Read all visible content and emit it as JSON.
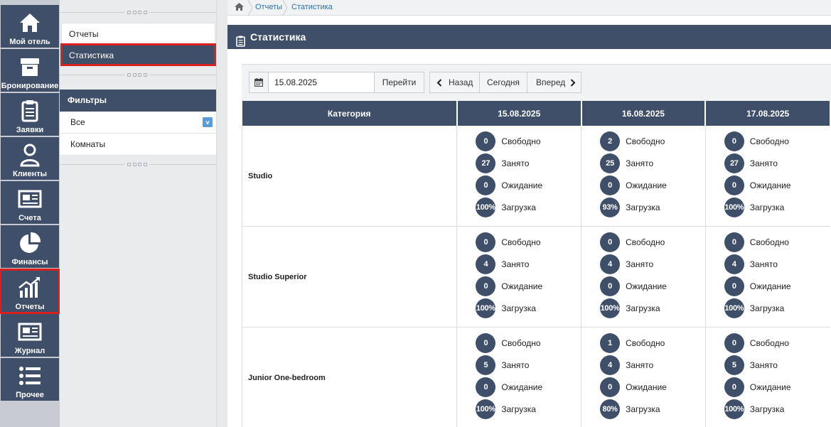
{
  "nav": [
    {
      "label": "Мой отель",
      "icon": "home-icon"
    },
    {
      "label": "Бронирование",
      "icon": "archive-box-icon"
    },
    {
      "label": "Заявки",
      "icon": "clipboard-icon"
    },
    {
      "label": "Клиенты",
      "icon": "user-icon"
    },
    {
      "label": "Счета",
      "icon": "invoice-icon"
    },
    {
      "label": "Финансы",
      "icon": "pie-chart-icon"
    },
    {
      "label": "Отчеты",
      "icon": "bar-chart-icon",
      "selected": true
    },
    {
      "label": "Журнал",
      "icon": "newspaper-icon"
    },
    {
      "label": "Прочее",
      "icon": "list-icon"
    }
  ],
  "submenu": {
    "items": [
      {
        "label": "Отчеты"
      },
      {
        "label": "Статистика",
        "active": true
      }
    ],
    "filters_title": "Фильтры",
    "filters": [
      {
        "label": "Все",
        "badge": "v"
      },
      {
        "label": "Комнаты"
      }
    ]
  },
  "breadcrumb": [
    "Отчеты",
    "Статистика"
  ],
  "page": {
    "title": "Статистика"
  },
  "toolbar": {
    "date_value": "15.08.2025",
    "go_label": "Перейти",
    "back_label": "Назад",
    "today_label": "Сегодня",
    "forward_label": "Вперед"
  },
  "table": {
    "category_header": "Категория",
    "dates": [
      "15.08.2025",
      "16.08.2025",
      "17.08.2025"
    ],
    "stat_labels": [
      "Свободно",
      "Занято",
      "Ожидание",
      "Загрузка"
    ],
    "rows": [
      {
        "category": "Studio",
        "cells": [
          [
            "0",
            "27",
            "0",
            "100%"
          ],
          [
            "2",
            "25",
            "0",
            "93%"
          ],
          [
            "0",
            "27",
            "0",
            "100%"
          ]
        ]
      },
      {
        "category": "Studio Superior",
        "cells": [
          [
            "0",
            "4",
            "0",
            "100%"
          ],
          [
            "0",
            "4",
            "0",
            "100%"
          ],
          [
            "0",
            "4",
            "0",
            "100%"
          ]
        ]
      },
      {
        "category": "Junior One-bedroom",
        "cells": [
          [
            "0",
            "5",
            "0",
            "100%"
          ],
          [
            "1",
            "4",
            "0",
            "80%"
          ],
          [
            "0",
            "5",
            "0",
            "100%"
          ]
        ]
      }
    ]
  },
  "colors": {
    "header_bg": "#3f4f6a",
    "highlight": "#d9201f",
    "link": "#2b6fb3"
  }
}
